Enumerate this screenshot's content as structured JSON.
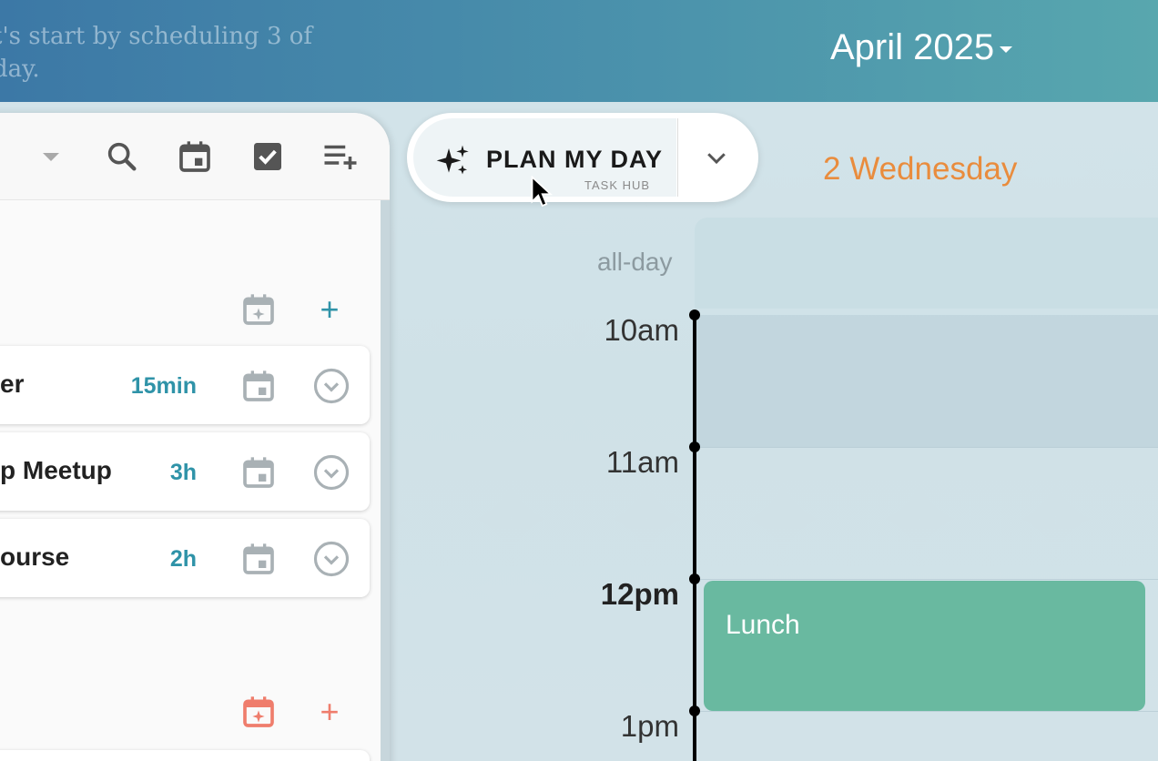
{
  "header": {
    "message": "t's start by scheduling 3 of\nday.",
    "month_label": "April 2025"
  },
  "toolbar": {
    "icons": [
      "dropdown-caret",
      "search-icon",
      "calendar-icon",
      "checkbox-icon",
      "playlist-add-icon"
    ]
  },
  "sections": [
    {
      "icon": "calendar-star-icon",
      "add_label": "+",
      "accent": "#2f93a8"
    },
    {
      "icon": "calendar-star-icon",
      "add_label": "+",
      "accent": "#ef7d6c"
    }
  ],
  "tasks": [
    {
      "title": "er",
      "duration": "15min"
    },
    {
      "title": "p Meetup",
      "duration": "3h"
    },
    {
      "title": "ourse",
      "duration": "2h"
    }
  ],
  "plan": {
    "label": "PLAN MY DAY",
    "sub_label": "TASK HUB"
  },
  "calendar": {
    "day_header": "2 Wednesday",
    "allday_label": "all-day",
    "hours": [
      "10am",
      "11am",
      "12pm",
      "1pm"
    ],
    "events": [
      {
        "title": "Lunch",
        "color": "#69b9a0"
      }
    ]
  },
  "colors": {
    "accent_teal": "#2f93a8",
    "accent_orange": "#e98c3d",
    "accent_red": "#ef7d6c"
  }
}
